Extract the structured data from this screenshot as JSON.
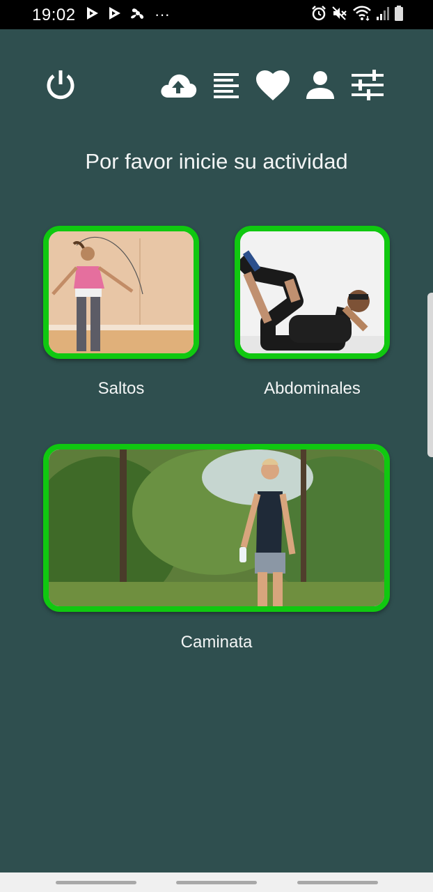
{
  "status_bar": {
    "time": "19:02",
    "overflow_indicator": "···",
    "left_icons": [
      "play-store-icon",
      "play-store-icon",
      "fan-icon"
    ],
    "right_icons": [
      "alarm-icon",
      "mute-icon",
      "wifi-icon",
      "signal-icon",
      "battery-icon"
    ]
  },
  "toolbar": {
    "icons": [
      "power-icon",
      "cloud-upload-icon",
      "list-icon",
      "heart-icon",
      "person-icon",
      "sliders-icon"
    ]
  },
  "main": {
    "prompt": "Por favor inicie su actividad",
    "activities": [
      {
        "label": "Saltos",
        "image": "jump-rope-photo"
      },
      {
        "label": "Abdominales",
        "image": "crunches-photo"
      },
      {
        "label": "Caminata",
        "image": "walking-photo"
      }
    ]
  },
  "colors": {
    "background": "#2f4f4f",
    "card_border": "#10c810",
    "text": "#ffffff"
  }
}
